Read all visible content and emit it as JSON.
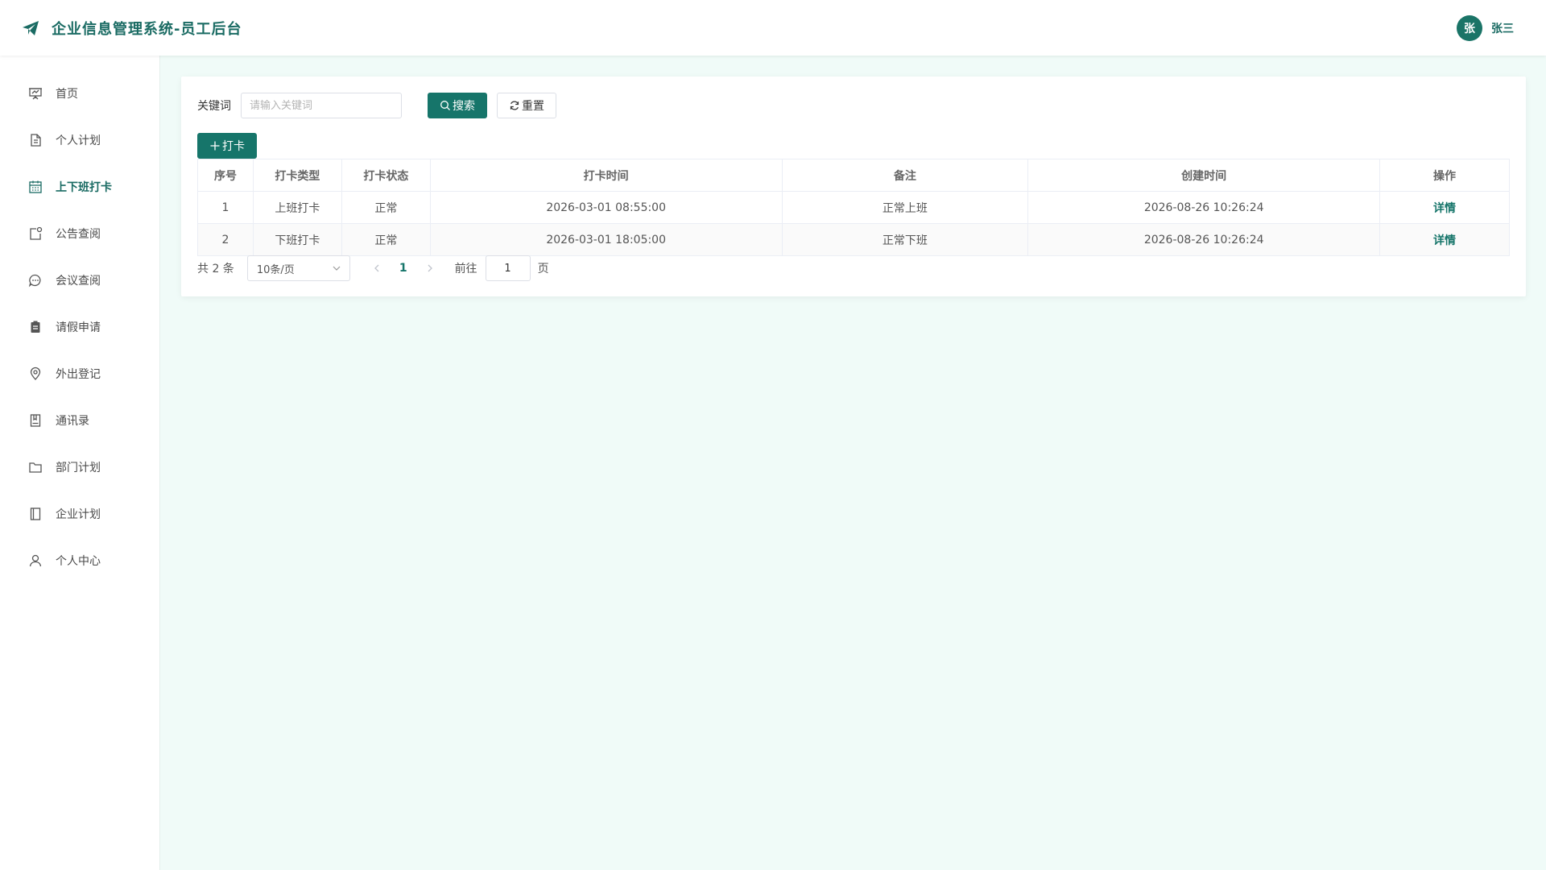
{
  "app": {
    "title": "企业信息管理系统-员工后台"
  },
  "user": {
    "avatar_text": "张",
    "name": "张三"
  },
  "sidebar": {
    "items": [
      {
        "label": "首页",
        "icon": "presentation-icon",
        "active": false
      },
      {
        "label": "个人计划",
        "icon": "document-icon",
        "active": false
      },
      {
        "label": "上下班打卡",
        "icon": "calendar-icon",
        "active": true
      },
      {
        "label": "公告查阅",
        "icon": "notice-icon",
        "active": false
      },
      {
        "label": "会议查阅",
        "icon": "chat-bubble-icon",
        "active": false
      },
      {
        "label": "请假申请",
        "icon": "clipboard-icon",
        "active": false
      },
      {
        "label": "外出登记",
        "icon": "location-pin-icon",
        "active": false
      },
      {
        "label": "通讯录",
        "icon": "contact-book-icon",
        "active": false
      },
      {
        "label": "部门计划",
        "icon": "folder-icon",
        "active": false
      },
      {
        "label": "企业计划",
        "icon": "notebook-icon",
        "active": false
      },
      {
        "label": "个人中心",
        "icon": "user-icon",
        "active": false
      }
    ]
  },
  "search": {
    "label": "关键词",
    "placeholder": "请输入关键词",
    "value": "",
    "search_button": "搜索",
    "reset_button": "重置"
  },
  "toolbar": {
    "add_button": "打卡"
  },
  "table": {
    "columns": [
      "序号",
      "打卡类型",
      "打卡状态",
      "打卡时间",
      "备注",
      "创建时间",
      "操作"
    ],
    "rows": [
      {
        "index": "1",
        "type": "上班打卡",
        "status": "正常",
        "time": "2026-03-01 08:55:00",
        "remark": "正常上班",
        "created": "2026-08-26 10:26:24",
        "action": "详情"
      },
      {
        "index": "2",
        "type": "下班打卡",
        "status": "正常",
        "time": "2026-03-01 18:05:00",
        "remark": "正常下班",
        "created": "2026-08-26 10:26:24",
        "action": "详情"
      }
    ]
  },
  "pagination": {
    "total_text": "共 2 条",
    "page_size": "10条/页",
    "current_page": "1",
    "goto_label": "前往",
    "goto_value": "1",
    "goto_suffix": "页"
  },
  "colors": {
    "accent": "#16756a",
    "background": "#f0fbf8"
  }
}
